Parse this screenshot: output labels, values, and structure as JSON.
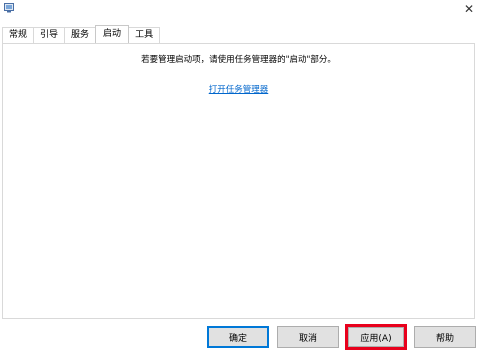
{
  "titlebar": {
    "icon": "msconfig-app-icon",
    "close_glyph": "✕"
  },
  "tabs": [
    {
      "label": "常规",
      "active": false
    },
    {
      "label": "引导",
      "active": false
    },
    {
      "label": "服务",
      "active": false
    },
    {
      "label": "启动",
      "active": true
    },
    {
      "label": "工具",
      "active": false
    }
  ],
  "startup_panel": {
    "message": "若要管理启动项，请使用任务管理器的\"启动\"部分。",
    "link_text": "打开任务管理器"
  },
  "buttons": {
    "ok": "确定",
    "cancel": "取消",
    "apply": "应用(A)",
    "help": "帮助"
  },
  "colors": {
    "link": "#0066cc",
    "highlight": "#e8001c",
    "default_button_border": "#0078d7"
  }
}
